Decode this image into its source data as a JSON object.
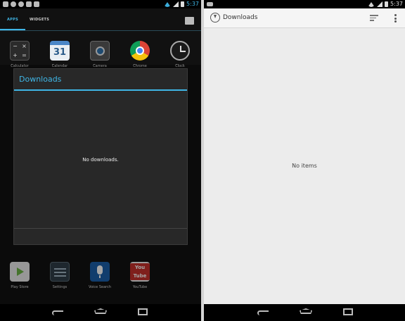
{
  "left_screen": {
    "status_time": "5:37",
    "tabs": {
      "apps": "APPS",
      "widgets": "WIDGETS"
    },
    "apps_top": [
      {
        "label": "Calculator",
        "icon": "calculator-icon"
      },
      {
        "label": "Calendar",
        "icon": "calendar-icon",
        "glyph": "31"
      },
      {
        "label": "Camera",
        "icon": "camera-icon"
      },
      {
        "label": "Chrome",
        "icon": "chrome-icon"
      },
      {
        "label": "Clock",
        "icon": "clock-icon"
      }
    ],
    "apps_bottom": [
      {
        "label": "Play Store",
        "icon": "play-store-icon"
      },
      {
        "label": "Settings",
        "icon": "settings-icon"
      },
      {
        "label": "Voice Search",
        "icon": "voice-search-icon"
      },
      {
        "label": "YouTube",
        "icon": "youtube-icon",
        "glyph": "You Tube"
      }
    ],
    "dialog": {
      "title": "Downloads",
      "message": "No downloads."
    },
    "accent_color": "#3fb6e6"
  },
  "right_screen": {
    "status_time": "5:37",
    "title": "Downloads",
    "empty_text": "No items",
    "background_color": "#ececec"
  }
}
